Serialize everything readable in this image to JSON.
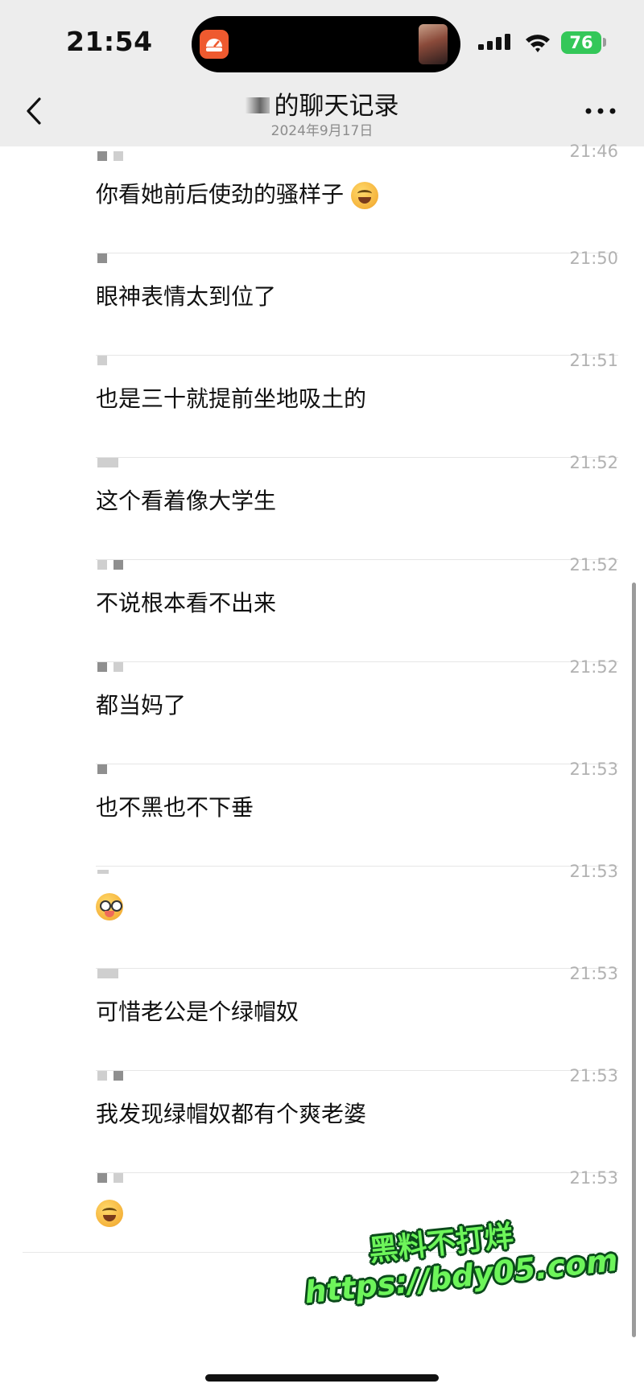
{
  "status_bar": {
    "time": "21:54",
    "battery": "76",
    "colors": {
      "battery": "#34c759",
      "island": "#000000"
    }
  },
  "nav": {
    "title": "的聊天记录",
    "subtitle": "2024年9月17日",
    "back_icon": "chevron-left-icon",
    "more_icon": "more-dots-icon"
  },
  "messages": [
    {
      "time": "21:46",
      "text": "你看她前后使劲的骚样子",
      "emoji": "laugh-cry"
    },
    {
      "time": "21:50",
      "text": "眼神表情太到位了",
      "emoji": ""
    },
    {
      "time": "21:51",
      "text": "也是三十就提前坐地吸土的",
      "emoji": ""
    },
    {
      "time": "21:52",
      "text": "这个看着像大学生",
      "emoji": ""
    },
    {
      "time": "21:52",
      "text": "不说根本看不出来",
      "emoji": ""
    },
    {
      "time": "21:52",
      "text": "都当妈了",
      "emoji": ""
    },
    {
      "time": "21:53",
      "text": "也不黑也不下垂",
      "emoji": ""
    },
    {
      "time": "21:53",
      "text": "",
      "emoji": "nerd"
    },
    {
      "time": "21:53",
      "text": "可惜老公是个绿帽奴",
      "emoji": ""
    },
    {
      "time": "21:53",
      "text": "我发现绿帽奴都有个爽老婆",
      "emoji": ""
    },
    {
      "time": "21:53",
      "text": "",
      "emoji": "laugh-cry"
    }
  ],
  "watermark": {
    "line1": "黑料不打烊",
    "line2": "https://bdy05.com",
    "color": "#6df55a"
  }
}
